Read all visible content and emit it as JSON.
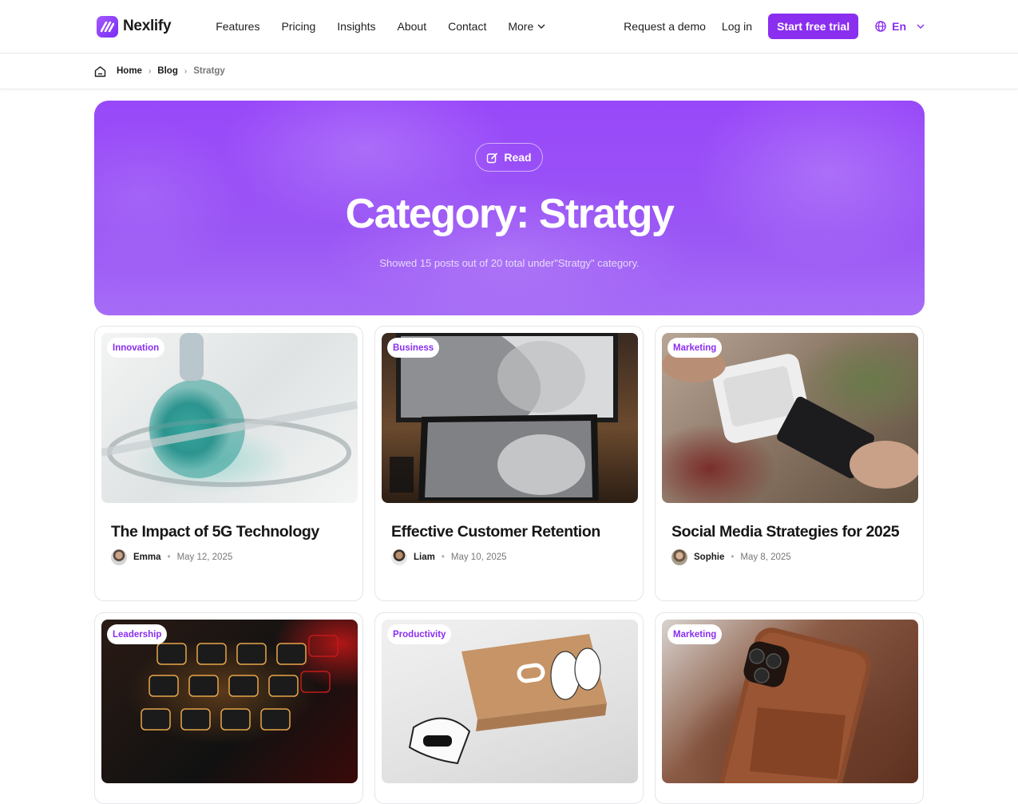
{
  "brand": {
    "name": "Nexlify"
  },
  "nav": {
    "menu": [
      "Features",
      "Pricing",
      "Insights",
      "About",
      "Contact",
      "More"
    ],
    "request_demo": "Request a demo",
    "login": "Log in",
    "cta": "Start free trial",
    "language": "En"
  },
  "breadcrumb": {
    "home": "Home",
    "blog": "Blog",
    "current": "Stratgy"
  },
  "hero": {
    "badge": "Read",
    "title": "Category: Stratgy",
    "subtitle": "Showed 15 posts out of 20 total under\"Stratgy\" category."
  },
  "posts": [
    {
      "tag": "Innovation",
      "title": "The Impact of 5G Technology",
      "author": "Emma",
      "date": "May 12, 2025"
    },
    {
      "tag": "Business",
      "title": "Effective Customer Retention",
      "author": "Liam",
      "date": "May 10, 2025"
    },
    {
      "tag": "Marketing",
      "title": "Social Media Strategies for 2025",
      "author": "Sophie",
      "date": "May 8, 2025"
    },
    {
      "tag": "Leadership"
    },
    {
      "tag": "Productivity"
    },
    {
      "tag": "Marketing"
    }
  ],
  "colors": {
    "accent": "#8a2ef0",
    "hero": "#9a55f5"
  }
}
